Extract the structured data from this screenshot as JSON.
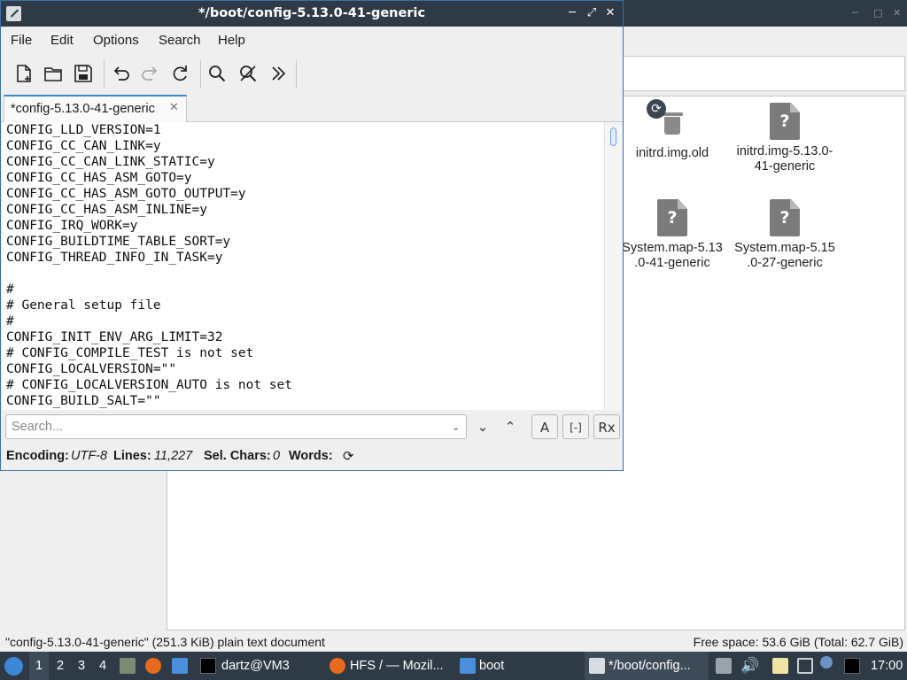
{
  "background": {
    "files": [
      {
        "name": "initrd.img.old",
        "icon": "trash-file-icon"
      },
      {
        "name": "initrd.img-5.13.0-41-generic",
        "line1": "initrd.img-5.13.0-",
        "line2": "41-generic",
        "icon": "unknown-file-icon"
      },
      {
        "name": "System.map-5.13.0-41-generic",
        "line1": "System.map-5.13",
        "line2": ".0-41-generic",
        "icon": "unknown-file-icon"
      },
      {
        "name": "System.map-5.15.0-27-generic",
        "line1": "System.map-5.15",
        "line2": ".0-27-generic",
        "icon": "unknown-file-icon"
      }
    ],
    "status_left": "\"config-5.13.0-41-generic\" (251.3 KiB) plain text document",
    "status_right": "Free space: 53.6 GiB (Total: 62.7 GiB)"
  },
  "editor": {
    "title": "*/boot/config-5.13.0-41-generic",
    "menus": [
      "File",
      "Edit",
      "Options",
      "Search",
      "Help"
    ],
    "tab_label": "*config-5.13.0-41-generic",
    "lines": [
      "CONFIG_LLD_VERSION=1",
      "CONFIG_CC_CAN_LINK=y",
      "CONFIG_CC_CAN_LINK_STATIC=y",
      "CONFIG_CC_HAS_ASM_GOTO=y",
      "CONFIG_CC_HAS_ASM_GOTO_OUTPUT=y",
      "CONFIG_CC_HAS_ASM_INLINE=y",
      "CONFIG_IRQ_WORK=y",
      "CONFIG_BUILDTIME_TABLE_SORT=y",
      "CONFIG_THREAD_INFO_IN_TASK=y",
      "",
      "#",
      "# General setup file",
      "#",
      "CONFIG_INIT_ENV_ARG_LIMIT=32",
      "# CONFIG_COMPILE_TEST is not set",
      "CONFIG_LOCALVERSION=\"\"",
      "# CONFIG_LOCALVERSION_AUTO is not set",
      "CONFIG_BUILD_SALT=\"\""
    ],
    "search_placeholder": "Search...",
    "search_buttons": {
      "case": "A",
      "whole_word": "[-]",
      "regex": "Rx"
    },
    "status": {
      "encoding_label": "Encoding:",
      "encoding": "UTF-8",
      "lines_label": "Lines:",
      "lines": "11,227",
      "sel_label": "Sel. Chars:",
      "sel": "0",
      "words_label": "Words:"
    }
  },
  "taskbar": {
    "workspaces": [
      "1",
      "2",
      "3",
      "4"
    ],
    "tasks": [
      {
        "label": "dartz@VM3",
        "icon": "terminal-icon"
      },
      {
        "label": "HFS / — Mozil...",
        "icon": "firefox-icon"
      },
      {
        "label": "boot",
        "icon": "folder-icon"
      },
      {
        "label": "*/boot/config...",
        "icon": "text-editor-icon"
      }
    ],
    "clock": "17:00"
  }
}
